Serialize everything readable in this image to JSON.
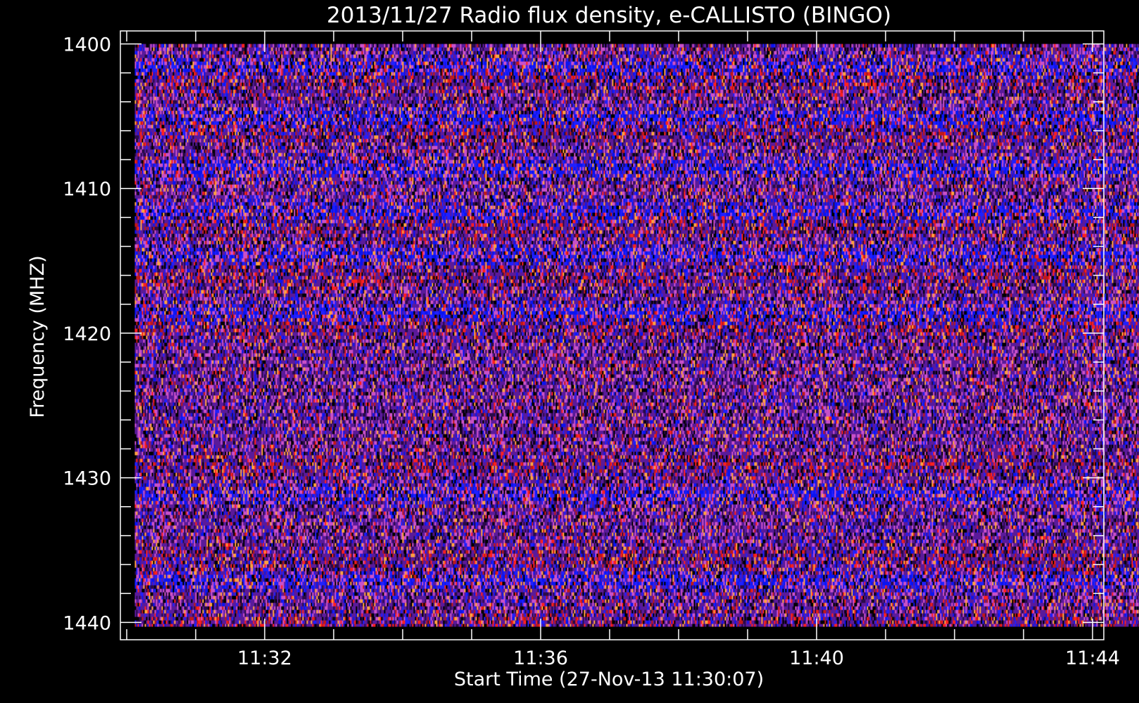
{
  "chart_data": {
    "type": "heatmap",
    "title": "2013/11/27  Radio flux density, e-CALLISTO (BINGO)",
    "xlabel": "Start Time (27-Nov-13 11:30:07)",
    "ylabel": "Frequency (MHZ)",
    "x_tick_labels": [
      "11:32",
      "11:36",
      "11:40",
      "11:44"
    ],
    "x_tick_minutes": [
      2,
      6,
      10,
      14
    ],
    "y_tick_labels": [
      "1400",
      "1410",
      "1420",
      "1430",
      "1440"
    ],
    "y_tick_values": [
      1400,
      1410,
      1420,
      1430,
      1440
    ],
    "ylim": [
      1399.1,
      1441.2
    ],
    "data_extent": {
      "start_time": "11:30:07",
      "end_time": "11:45:07",
      "freq_min_mhz": 1400,
      "freq_max_mhz": 1440.3
    },
    "y_axis_reversed": true,
    "grid": false,
    "colormap": [
      "#000000",
      "#2a0a4a",
      "#5a1a9a",
      "#0a14f0",
      "#2020ff",
      "#c01818",
      "#ff2020",
      "#c850c8",
      "#ffa040"
    ],
    "band_profile": {
      "blue_bands_mhz": [
        1401.5,
        1405,
        1408.5,
        1411.5,
        1414.5,
        1418.5,
        1431,
        1437
      ],
      "red_bands_mhz": [
        1402.5,
        1406,
        1412.5,
        1416,
        1419.5,
        1429,
        1435.5,
        1440
      ]
    }
  },
  "colors": {
    "background": "#000000",
    "axis": "#ffffff",
    "text": "#ffffff"
  }
}
